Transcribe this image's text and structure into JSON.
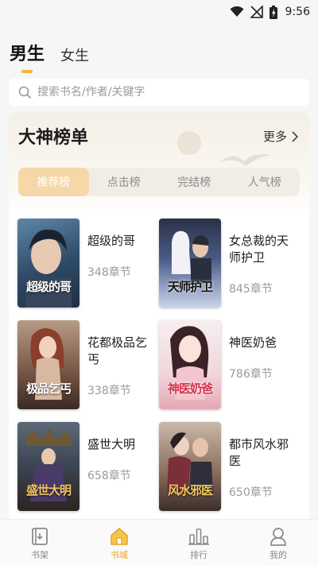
{
  "status_bar": {
    "time": "9:56"
  },
  "gender_tabs": [
    {
      "label": "男生",
      "active": true
    },
    {
      "label": "女生",
      "active": false
    }
  ],
  "search": {
    "placeholder": "搜索书名/作者/关键字"
  },
  "ranking": {
    "title": "大神榜单",
    "more_label": "更多",
    "tabs": [
      {
        "label": "推荐榜",
        "active": true
      },
      {
        "label": "点击榜",
        "active": false
      },
      {
        "label": "完结榜",
        "active": false
      },
      {
        "label": "人气榜",
        "active": false
      }
    ],
    "books": [
      {
        "title": "超级的哥",
        "chapters": "348章节",
        "cover_text": "超级的哥"
      },
      {
        "title": "女总裁的天师护卫",
        "chapters": "845章节",
        "cover_text": "天师护卫"
      },
      {
        "title": "花都极品乞丐",
        "chapters": "338章节",
        "cover_text": "极品乞丐"
      },
      {
        "title": "神医奶爸",
        "chapters": "786章节",
        "cover_text": "神医奶爸"
      },
      {
        "title": "盛世大明",
        "chapters": "658章节",
        "cover_text": "盛世大明"
      },
      {
        "title": "都市风水邪医",
        "chapters": "650章节",
        "cover_text": "风水邪医"
      }
    ]
  },
  "bottom_nav": [
    {
      "label": "书架",
      "icon": "bookshelf-icon",
      "active": false
    },
    {
      "label": "书城",
      "icon": "home-icon",
      "active": true
    },
    {
      "label": "排行",
      "icon": "rank-chart-icon",
      "active": false
    },
    {
      "label": "我的",
      "icon": "user-icon",
      "active": false
    }
  ],
  "colors": {
    "accent": "#f3b640",
    "active_tab_bg": "#f6d8a8",
    "nav_active": "#e8a52b"
  }
}
